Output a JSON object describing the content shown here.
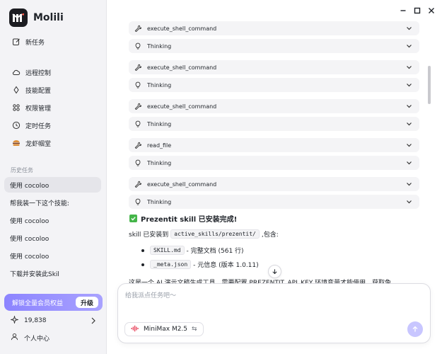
{
  "app": {
    "name": "Molili"
  },
  "colors": {
    "accent": "#8c84ff",
    "success": "#44b549",
    "sidebar_bg": "#f3f3f6"
  },
  "sidebar": {
    "new_task": "新任务",
    "nav": [
      {
        "label": "远程控制",
        "icon": "cloud-icon"
      },
      {
        "label": "技能配置",
        "icon": "diamond-icon"
      },
      {
        "label": "权限管理",
        "icon": "grid-icon"
      },
      {
        "label": "定时任务",
        "icon": "clock-icon"
      },
      {
        "label": "龙虾帼堂",
        "icon": "burger-icon"
      }
    ],
    "history_label": "历史任务",
    "history": [
      {
        "label": "使用 cocoloo",
        "active": true
      },
      {
        "label": "帮我装一下这个技能:",
        "active": false
      },
      {
        "label": "使用 cocoloo",
        "active": false
      },
      {
        "label": "使用 cocoloo",
        "active": false
      },
      {
        "label": "使用 cocoloo",
        "active": false
      },
      {
        "label": "下载并安装此Skil",
        "active": false
      }
    ],
    "upgrade": {
      "text": "解锁全量会员权益",
      "button": "升级"
    },
    "points": "19,838",
    "user_center": "个人中心"
  },
  "chat": {
    "tool_rows": [
      {
        "name": "execute_shell_command",
        "icon": "wrench-icon"
      },
      {
        "name": "Thinking",
        "icon": "bulb-icon"
      },
      {
        "name": "execute_shell_command",
        "icon": "wrench-icon"
      },
      {
        "name": "Thinking",
        "icon": "bulb-icon"
      },
      {
        "name": "execute_shell_command",
        "icon": "wrench-icon"
      },
      {
        "name": "Thinking",
        "icon": "bulb-icon"
      },
      {
        "name": "read_file",
        "icon": "wrench-icon"
      },
      {
        "name": "Thinking",
        "icon": "bulb-icon"
      },
      {
        "name": "execute_shell_command",
        "icon": "wrench-icon"
      },
      {
        "name": "Thinking",
        "icon": "bulb-icon"
      }
    ],
    "result_title": "Prezentit skill 已安装完成!",
    "installed_prefix": "skill 已安装到",
    "installed_path": "active_skills/prezentit/",
    "installed_suffix": ",包含:",
    "bullets": [
      {
        "code": "SKILL.md",
        "text": "- 完整文档 (561 行)"
      },
      {
        "code": "_meta.json",
        "text": "- 元信息 (版本 1.0.11)"
      }
    ],
    "cut_line": "这是一个 AI 演示文稿生成工具，需要配置 PREZENTIT_API_KEY 环境变量才能使用。获取免"
  },
  "composer": {
    "placeholder": "给我派点任务吧～",
    "model": "MiniMax M2.5",
    "switch_icon": "⇆"
  }
}
